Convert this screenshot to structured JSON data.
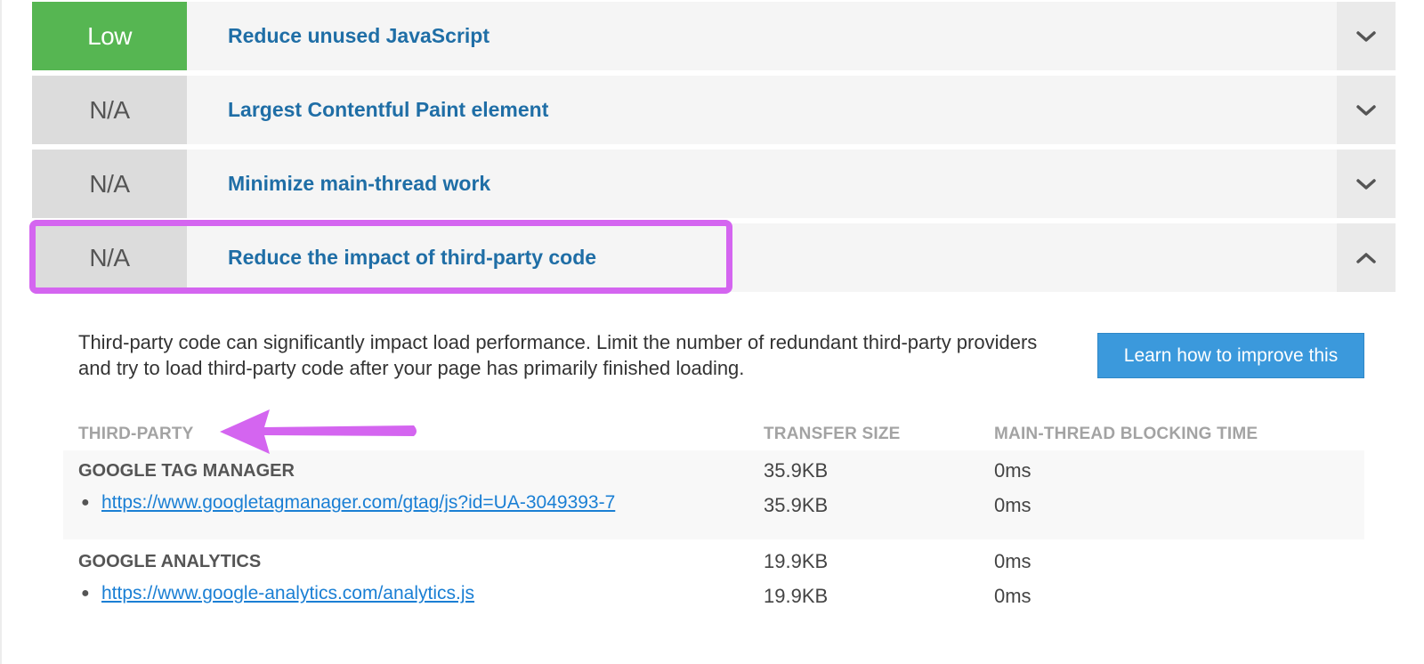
{
  "audits": [
    {
      "score": "Low",
      "title": "Reduce unused JavaScript",
      "expanded": false
    },
    {
      "score": "N/A",
      "title": "Largest Contentful Paint element",
      "expanded": false
    },
    {
      "score": "N/A",
      "title": "Minimize main-thread work",
      "expanded": false
    },
    {
      "score": "N/A",
      "title": "Reduce the impact of third-party code",
      "expanded": true
    }
  ],
  "details": {
    "description": "Third-party code can significantly impact load performance. Limit the number of redundant third-party providers and try to load third-party code after your page has primarily finished loading.",
    "learn_button": "Learn how to improve this",
    "columns": {
      "third_party": "THIRD-PARTY",
      "transfer_size": "TRANSFER SIZE",
      "blocking_time": "MAIN-THREAD BLOCKING TIME"
    },
    "groups": [
      {
        "name": "GOOGLE TAG MANAGER",
        "transfer_size": "35.9KB",
        "blocking_time": "0ms",
        "items": [
          {
            "url": "https://www.googletagmanager.com/gtag/js?id=UA-3049393-7",
            "transfer_size": "35.9KB",
            "blocking_time": "0ms"
          }
        ]
      },
      {
        "name": "GOOGLE ANALYTICS",
        "transfer_size": "19.9KB",
        "blocking_time": "0ms",
        "items": [
          {
            "url": "https://www.google-analytics.com/analytics.js",
            "transfer_size": "19.9KB",
            "blocking_time": "0ms"
          }
        ]
      }
    ]
  },
  "colors": {
    "score_low": "#56b652",
    "score_na": "#dcdcdc",
    "title_link": "#1f6ea6",
    "highlight": "#d465f0",
    "button": "#3b99dc"
  },
  "icons": {
    "collapsed": "chevron-down-icon",
    "expanded": "chevron-up-icon",
    "annotation": "arrow-left-icon"
  }
}
